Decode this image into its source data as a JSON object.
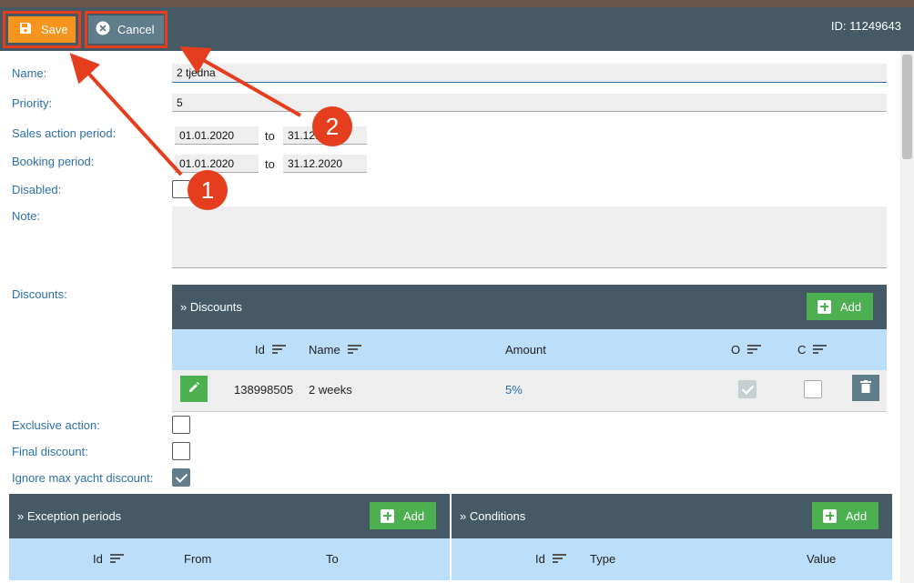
{
  "toolbar": {
    "save_label": "Save",
    "cancel_label": "Cancel",
    "id_text": "ID: 11249643"
  },
  "form": {
    "name_label": "Name:",
    "name_value": "2 tjedna",
    "priority_label": "Priority:",
    "priority_value": "5",
    "sales_label": "Sales action period:",
    "sales_from": "01.01.2020",
    "sales_to": "31.12.",
    "booking_label": "Booking period:",
    "booking_from": "01.01.2020",
    "booking_to": "31.12.2020",
    "to_label": "to",
    "disabled_label": "Disabled:",
    "note_label": "Note:",
    "discounts_label": "Discounts:",
    "exclusive_label": "Exclusive action:",
    "final_label": "Final discount:",
    "ignore_label": "Ignore max yacht discount:"
  },
  "discounts": {
    "title": "» Discounts",
    "add_label": "Add",
    "columns": [
      "Id",
      "Name",
      "Amount",
      "O",
      "C"
    ],
    "rows": [
      {
        "id": "138998505",
        "name": "2 weeks",
        "amount": "5%",
        "o": true,
        "c": false
      }
    ]
  },
  "exceptions": {
    "title": "» Exception periods",
    "add_label": "Add",
    "columns": [
      "Id",
      "From",
      "To"
    ]
  },
  "conditions": {
    "title": "» Conditions",
    "add_label": "Add",
    "columns": [
      "Id",
      "Type",
      "Value"
    ]
  },
  "checkboxes": {
    "disabled": false,
    "exclusive": false,
    "final": false,
    "ignore_max": true
  },
  "annotations": {
    "badge_1": "1",
    "badge_2": "2"
  },
  "colors": {
    "toolbar": "#455a64",
    "save": "#f7941d",
    "cancel": "#607d8b",
    "add": "#4caf50",
    "table_head": "#bbdefb",
    "highlight": "#e53e1e",
    "label": "#2d6fa8"
  },
  "icons": {
    "save": "floppy-disk-icon",
    "cancel": "close-circle-icon",
    "add": "plus-box-icon",
    "sort": "sort-icon",
    "edit": "pencil-icon",
    "delete": "trash-icon"
  }
}
